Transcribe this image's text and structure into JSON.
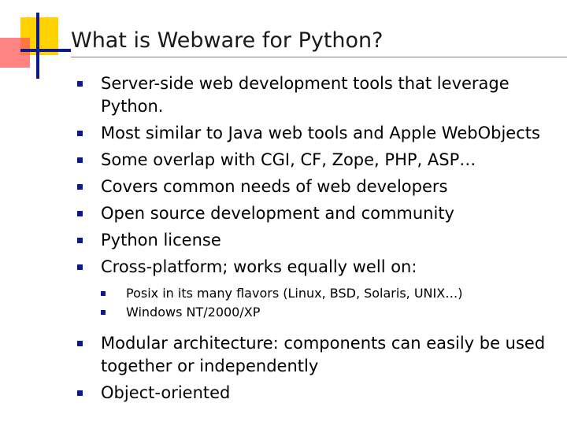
{
  "slide": {
    "title": "What is Webware for Python?",
    "bullets": [
      {
        "text": "Server-side web development tools that leverage Python."
      },
      {
        "text": "Most similar to Java web tools and Apple WebObjects"
      },
      {
        "text": "Some overlap with CGI, CF, Zope, PHP, ASP…"
      },
      {
        "text": "Covers common needs of web developers"
      },
      {
        "text": "Open source development and community"
      },
      {
        "text": "Python license"
      },
      {
        "text": "Cross-platform; works equally well on:"
      }
    ],
    "sub_bullets": [
      {
        "text": "Posix in its many flavors (Linux, BSD, Solaris, UNIX…)"
      },
      {
        "text": "Windows NT/2000/XP"
      }
    ],
    "bullets_after": [
      {
        "text": "Modular architecture: components can easily be used together or independently"
      },
      {
        "text": "Object-oriented"
      }
    ],
    "colors": {
      "bullet": "#0a1a8c",
      "logo_yellow": "#ffd200",
      "logo_red": "#ff5a5a"
    }
  }
}
